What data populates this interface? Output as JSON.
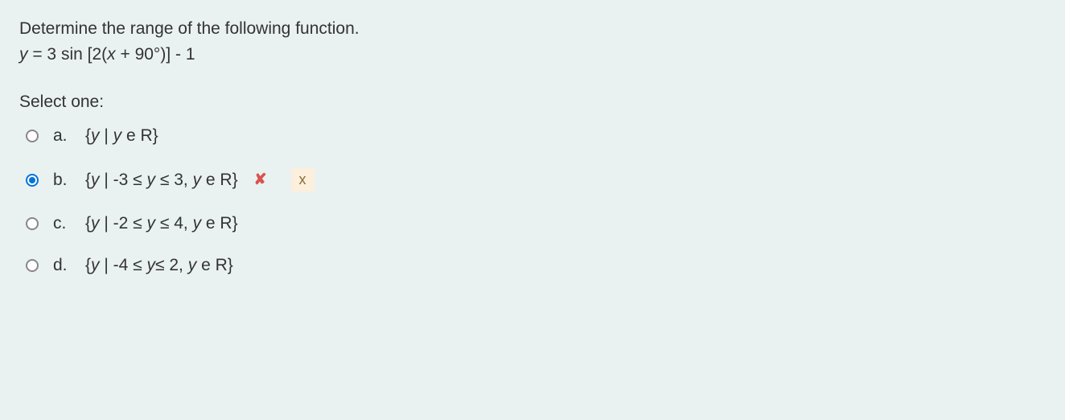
{
  "question": {
    "prompt": "Determine the range of the following function.",
    "equation_y": "y",
    "equation_eq": " = 3 sin [2(",
    "equation_x": "x",
    "equation_tail": " + 90°)] - 1"
  },
  "select_label": "Select one:",
  "options": {
    "a": {
      "letter": "a.",
      "pre": "{",
      "var": "y",
      "mid": " | ",
      "var2": "y",
      "tail": " e R}",
      "selected": false
    },
    "b": {
      "letter": "b.",
      "pre": "{",
      "var": "y",
      "mid": " | -3 ≤ ",
      "var2": "y",
      "mid2": " ≤ 3, ",
      "var3": "y",
      "tail": " e R}",
      "selected": true,
      "incorrect": true
    },
    "c": {
      "letter": "c.",
      "pre": "{",
      "var": "y",
      "mid": " | -2 ≤ ",
      "var2": "y",
      "mid2": " ≤ 4, ",
      "var3": "y",
      "tail": " e R}",
      "selected": false
    },
    "d": {
      "letter": "d.",
      "pre": "{",
      "var": "y",
      "mid": " | -4 ≤ ",
      "var2": "y",
      "mid2": "≤ 2, ",
      "var3": "y",
      "tail": " e R}",
      "selected": false
    }
  },
  "feedback": {
    "x_mark": "✘",
    "badge": "x"
  }
}
